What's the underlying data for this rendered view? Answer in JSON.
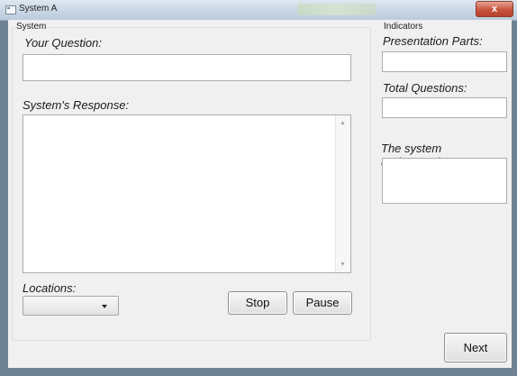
{
  "window": {
    "title": "System A",
    "close_glyph": "x"
  },
  "system_group": {
    "label": "System",
    "question_label": "Your Question:",
    "question_value": "",
    "response_label": "System's Response:",
    "response_value": "",
    "locations_label": "Locations:",
    "locations_selected": "",
    "stop_label": "Stop",
    "pause_label": "Pause"
  },
  "indicators_group": {
    "label": "Indicators",
    "presentation_parts_label": "Presentation Parts:",
    "presentation_parts_value": "",
    "total_questions_label": "Total Questions:",
    "total_questions_value": "",
    "understands_label": "The system understands:",
    "understands_value": ""
  },
  "next_label": "Next",
  "icons": {
    "scroll_up": "scroll-up-icon",
    "scroll_down": "scroll-down-icon",
    "dropdown": "chevron-down-icon",
    "app": "app-icon"
  }
}
